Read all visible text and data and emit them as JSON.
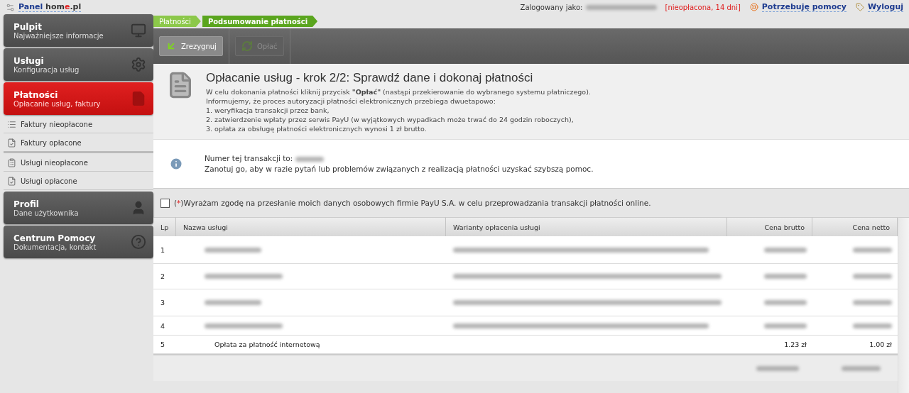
{
  "brand": {
    "first": "Panel",
    "second": "hom",
    "accent": "e",
    "third": ".pl"
  },
  "topbar": {
    "login_label": "Zalogowany jako:",
    "login_redacted": true,
    "status": "[nieopłacona, 14 dni]",
    "help": "Potrzebuję pomocy",
    "logout": "Wyloguj"
  },
  "sidebar": {
    "items": [
      {
        "kind": "main",
        "title": "Pulpit",
        "subtitle": "Najważniejsze informacje",
        "selected": false
      },
      {
        "kind": "main",
        "title": "Usługi",
        "subtitle": "Konfiguracja usług",
        "selected": false
      },
      {
        "kind": "main",
        "title": "Płatności",
        "subtitle": "Opłacanie usług, faktury",
        "selected": true
      },
      {
        "kind": "sub",
        "title": "Faktury nieopłacone",
        "group_end": false
      },
      {
        "kind": "sub",
        "title": "Faktury opłacone",
        "group_end": true
      },
      {
        "kind": "sub",
        "title": "Usługi nieopłacone",
        "group_end": false
      },
      {
        "kind": "sub",
        "title": "Usługi opłacone",
        "group_end": false
      },
      {
        "kind": "main",
        "title": "Profil",
        "subtitle": "Dane użytkownika",
        "selected": false
      },
      {
        "kind": "main",
        "title": "Centrum Pomocy",
        "subtitle": "Dokumentacja, kontakt",
        "selected": false
      }
    ]
  },
  "breadcrumbs": [
    {
      "label": "Płatności",
      "selected": false
    },
    {
      "label": "Podsumowanie płatności",
      "selected": true
    }
  ],
  "toolbar": [
    {
      "label": "Zrezygnuj",
      "disabled": false
    },
    {
      "label": "Opłać",
      "disabled": true
    }
  ],
  "header": {
    "title": "Opłacanie usług - krok 2/2: Sprawdź dane i dokonaj płatności",
    "lines": [
      "W celu dokonania płatności kliknij przycisk **\"Opłać\"** (nastąpi przekierowanie do wybranego systemu płatniczego).",
      "Informujemy, że proces autoryzacji płatności elektronicznych przebiega dwuetapowo:",
      "1. weryfikacja transakcji przez bank,",
      "2. zatwierdzenie wpłaty przez serwis PayU (w wyjątkowych wypadkach może trwać do 24 godzin roboczych),",
      "3. opłata za obsługę płatności elektronicznych wynosi 1 zł brutto."
    ]
  },
  "info": {
    "line1": "Numer tej transakcji to:",
    "number_redacted": true,
    "line2": "Zanotuj go, aby w razie pytań lub problemów związanych z realizacją płatności uzyskać szybszą pomoc."
  },
  "consent": {
    "checked": false,
    "open": "(",
    "mark": "*",
    "text": ")Wyrażam zgodę na przesłanie moich danych osobowych firmie PayU S.A. w celu przeprowadzania transakcji płatności online."
  },
  "table": {
    "columns": [
      "Lp",
      "Nazwa usługi",
      "Warianty opłacenia usługi",
      "Cena brutto",
      "Cena netto"
    ],
    "rows": [
      {
        "lp": "1",
        "redacted": true
      },
      {
        "lp": "2",
        "redacted": true
      },
      {
        "lp": "3",
        "redacted": true
      },
      {
        "lp": "4",
        "redacted": true
      },
      {
        "lp": "5",
        "redacted": false,
        "name": "Opłata za płatność internetową",
        "brutto": "1.23 zł",
        "netto": "1.00 zł"
      }
    ],
    "totals_redacted": true
  }
}
